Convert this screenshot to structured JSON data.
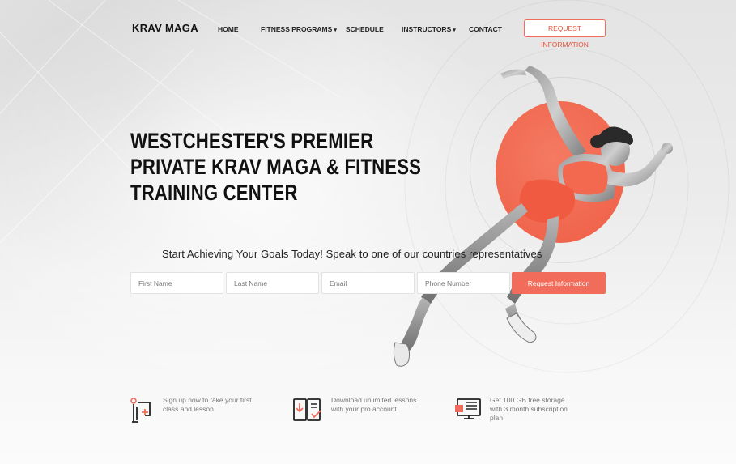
{
  "brand": {
    "logo": "KRAV MAGA",
    "accent": "#f26c5b"
  },
  "nav": {
    "items": [
      {
        "label": "HOME",
        "dropdown": false
      },
      {
        "label": "FITNESS PROGRAMS",
        "dropdown": true
      },
      {
        "label": "SCHEDULE",
        "dropdown": false
      },
      {
        "label": "INSTRUCTORS",
        "dropdown": true
      },
      {
        "label": "CONTACT",
        "dropdown": false
      }
    ],
    "cta_label": "REQUEST INFORMATION"
  },
  "hero": {
    "headline_lines": [
      "WESTCHESTER'S PREMIER",
      "PRIVATE KRAV MAGA & FITNESS",
      "TRAINING CENTER"
    ],
    "subhead": "Start Achieving Your Goals Today! Speak to one of our countries representatives"
  },
  "form": {
    "first_name_placeholder": "First Name",
    "last_name_placeholder": "Last Name",
    "email_placeholder": "Email",
    "phone_placeholder": "Phone Number",
    "submit_label": "Request Information"
  },
  "features": [
    {
      "icon": "signup-icon",
      "text": "Sign up now to take your first class and lesson"
    },
    {
      "icon": "download-lessons-icon",
      "text": "Download unlimited lessons with your pro account"
    },
    {
      "icon": "storage-icon",
      "text": "Get 100 GB free storage with 3 month subscription plan"
    }
  ]
}
